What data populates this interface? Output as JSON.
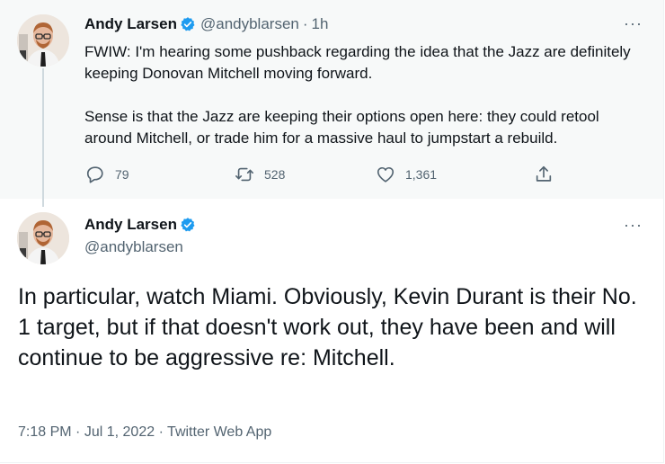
{
  "parent_tweet": {
    "author": {
      "name": "Andy Larsen",
      "handle": "@andyblarsen",
      "verified": true
    },
    "separator": "·",
    "time": "1h",
    "more": "···",
    "paragraphs": [
      "FWIW: I'm hearing some pushback regarding the idea that the Jazz are definitely keeping Donovan Mitchell moving forward.",
      "Sense is that the Jazz are keeping their options open here: they could retool around Mitchell, or trade him for a massive haul to jumpstart a rebuild."
    ],
    "actions": {
      "replies": "79",
      "retweets": "528",
      "likes": "1,361"
    }
  },
  "main_tweet": {
    "author": {
      "name": "Andy Larsen",
      "handle": "@andyblarsen",
      "verified": true
    },
    "more": "···",
    "text": "In particular, watch Miami. Obviously, Kevin Durant is their No. 1 target, but if that doesn't work out, they have been and will continue to be aggressive re: Mitchell.",
    "meta": {
      "time": "7:18 PM",
      "date": "Jul 1, 2022",
      "source": "Twitter Web App",
      "separator": "·"
    }
  },
  "colors": {
    "verified_badge": "#1d9bf0",
    "secondary_text": "#536471",
    "parent_background": "#f7f9f9",
    "thread_line": "#cfd9de"
  },
  "icons": [
    "verified-badge-icon",
    "reply-icon",
    "retweet-icon",
    "like-icon",
    "share-icon",
    "more-icon"
  ]
}
